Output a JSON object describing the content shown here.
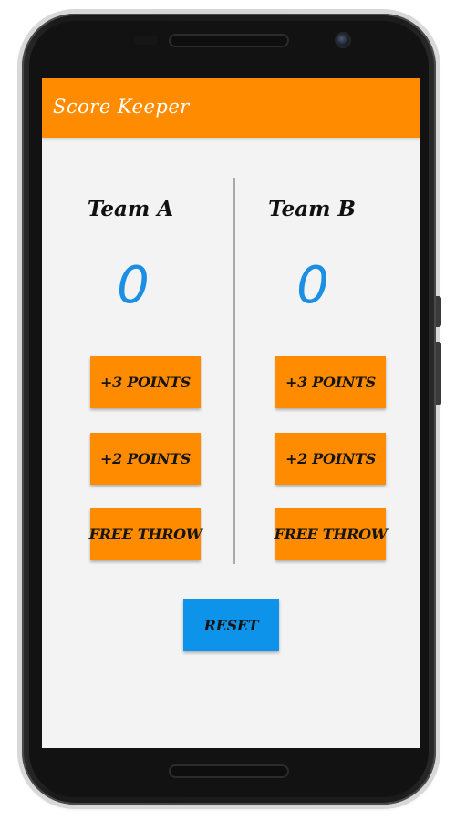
{
  "app_bar": {
    "title": "Score Keeper",
    "color": "#ff8c00"
  },
  "team_a": {
    "name": "Team A",
    "score": "0",
    "buttons": {
      "three_points": "+3 POINTS",
      "two_points": "+2 POINTS",
      "free_throw": "FREE THROW"
    }
  },
  "team_b": {
    "name": "Team B",
    "score": "0",
    "buttons": {
      "three_points": "+3 POINTS",
      "two_points": "+2 POINTS",
      "free_throw": "FREE THROW"
    }
  },
  "reset": {
    "label": "RESET",
    "color": "#0d93ea"
  },
  "colors": {
    "accent": "#ff8c00",
    "score_text": "#1a8fe3",
    "background": "#f3f3f3"
  }
}
